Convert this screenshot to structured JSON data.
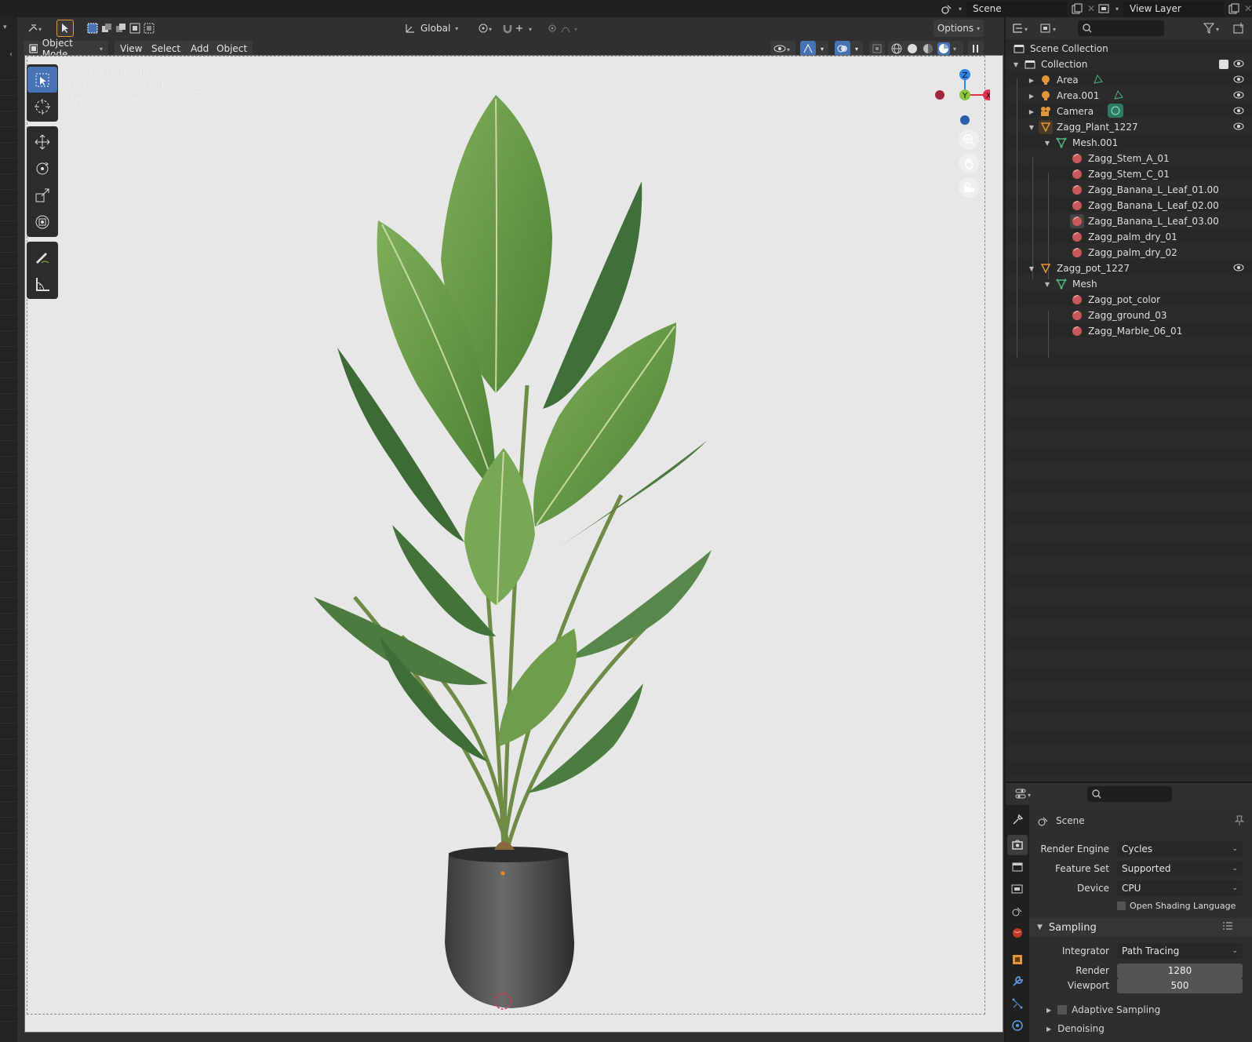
{
  "topbar": {
    "scene_name": "Scene",
    "view_layer_name": "View Layer"
  },
  "viewport": {
    "header": {
      "transform_orientation": "Global",
      "options_label": "Options"
    },
    "mode_label": "Object Mode",
    "menus": [
      "View",
      "Select",
      "Add",
      "Object"
    ],
    "overlay_text": {
      "line1": "Camera Perspective",
      "line2": "(1) Collection | Zagg_Plant_1227",
      "line3": "Rendering Done"
    },
    "gizmo": {
      "z": "Z",
      "y": "Y",
      "x": "X"
    },
    "colors": {
      "accent": "#4772b3",
      "x_axis": "#e0344b",
      "y_axis": "#8bc43f",
      "z_axis": "#2f85e6"
    }
  },
  "outliner": {
    "root_label": "Scene Collection",
    "items": [
      {
        "label": "Collection",
        "icon": "collection-icon",
        "depth": 0
      },
      {
        "label": "Area",
        "icon": "light-icon",
        "depth": 1
      },
      {
        "label": "Area.001",
        "icon": "light-icon",
        "depth": 1
      },
      {
        "label": "Camera",
        "icon": "camera-icon",
        "depth": 1
      },
      {
        "label": "Zagg_Plant_1227",
        "icon": "mesh-object-icon",
        "depth": 1
      },
      {
        "label": "Mesh.001",
        "icon": "mesh-data-icon",
        "depth": 2
      },
      {
        "label": "Zagg_Stem_A_01",
        "icon": "material-icon",
        "depth": 3
      },
      {
        "label": "Zagg_Stem_C_01",
        "icon": "material-icon",
        "depth": 3
      },
      {
        "label": "Zagg_Banana_L_Leaf_01.00",
        "icon": "material-icon",
        "depth": 3
      },
      {
        "label": "Zagg_Banana_L_Leaf_02.00",
        "icon": "material-icon",
        "depth": 3
      },
      {
        "label": "Zagg_Banana_L_Leaf_03.00",
        "icon": "material-icon",
        "depth": 3
      },
      {
        "label": "Zagg_palm_dry_01",
        "icon": "material-icon",
        "depth": 3
      },
      {
        "label": "Zagg_palm_dry_02",
        "icon": "material-icon",
        "depth": 3
      },
      {
        "label": "Zagg_pot_1227",
        "icon": "mesh-object-icon",
        "depth": 1
      },
      {
        "label": "Mesh",
        "icon": "mesh-data-icon",
        "depth": 2
      },
      {
        "label": "Zagg_pot_color",
        "icon": "material-icon",
        "depth": 3
      },
      {
        "label": "Zagg_ground_03",
        "icon": "material-icon",
        "depth": 3
      },
      {
        "label": "Zagg_Marble_06_01",
        "icon": "material-icon",
        "depth": 3
      }
    ]
  },
  "properties": {
    "context_title": "Scene",
    "render_engine": {
      "label": "Render Engine",
      "value": "Cycles"
    },
    "feature_set": {
      "label": "Feature Set",
      "value": "Supported"
    },
    "device": {
      "label": "Device",
      "value": "CPU"
    },
    "osl": {
      "label": "Open Shading Language",
      "checked": false
    },
    "sampling": {
      "title": "Sampling",
      "integrator": {
        "label": "Integrator",
        "value": "Path Tracing"
      },
      "render": {
        "label": "Render",
        "value": "1280"
      },
      "viewport": {
        "label": "Viewport",
        "value": "500"
      },
      "adaptive": {
        "label": "Adaptive Sampling",
        "checked": false
      },
      "denoising": {
        "label": "Denoising"
      }
    }
  }
}
